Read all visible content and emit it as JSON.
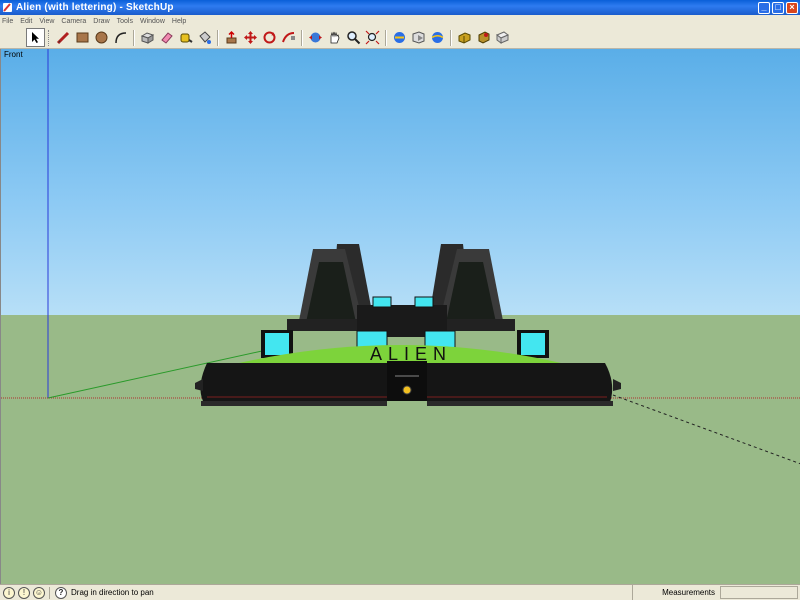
{
  "window": {
    "title": "Alien (with lettering) - SketchUp",
    "controls": [
      "_",
      "□",
      "×"
    ]
  },
  "menu": [
    "File",
    "Edit",
    "View",
    "Camera",
    "Draw",
    "Tools",
    "Window",
    "Help"
  ],
  "toolbar": {
    "tools": [
      {
        "name": "select",
        "icon": "arrow-cursor-icon"
      },
      {
        "name": "line",
        "icon": "pencil-icon"
      },
      {
        "name": "rectangle",
        "icon": "rectangle-icon"
      },
      {
        "name": "circle",
        "icon": "circle-icon"
      },
      {
        "name": "arc",
        "icon": "arc-icon"
      },
      {
        "name": "make-component",
        "icon": "component-icon"
      },
      {
        "name": "eraser",
        "icon": "eraser-icon"
      },
      {
        "name": "tape-measure",
        "icon": "tape-measure-icon"
      },
      {
        "name": "paint-bucket",
        "icon": "paint-bucket-icon"
      },
      {
        "name": "push-pull",
        "icon": "push-pull-icon"
      },
      {
        "name": "move",
        "icon": "move-icon"
      },
      {
        "name": "rotate",
        "icon": "rotate-icon"
      },
      {
        "name": "follow-me",
        "icon": "follow-me-icon"
      },
      {
        "name": "orbit",
        "icon": "orbit-icon"
      },
      {
        "name": "pan",
        "icon": "pan-icon"
      },
      {
        "name": "zoom",
        "icon": "zoom-icon"
      },
      {
        "name": "zoom-extents",
        "icon": "zoom-extents-icon"
      },
      {
        "name": "previous",
        "icon": "previous-view-icon"
      },
      {
        "name": "next",
        "icon": "next-view-icon"
      },
      {
        "name": "get-models",
        "icon": "get-models-icon"
      },
      {
        "name": "share-model",
        "icon": "share-model-icon"
      },
      {
        "name": "share-component",
        "icon": "share-component-icon"
      },
      {
        "name": "send-to-layout",
        "icon": "layout-icon"
      }
    ]
  },
  "viewport": {
    "view_name": "Front",
    "model_lettering": "ALIEN",
    "colors": {
      "sky": "#8fcbf4",
      "ground": "#99ba88",
      "body": "#111111",
      "deck": "#7dd33b",
      "lights": "#43e6f0"
    }
  },
  "status": {
    "hint": "Drag in direction to pan",
    "measurements_label": "Measurements",
    "measurements_value": ""
  }
}
